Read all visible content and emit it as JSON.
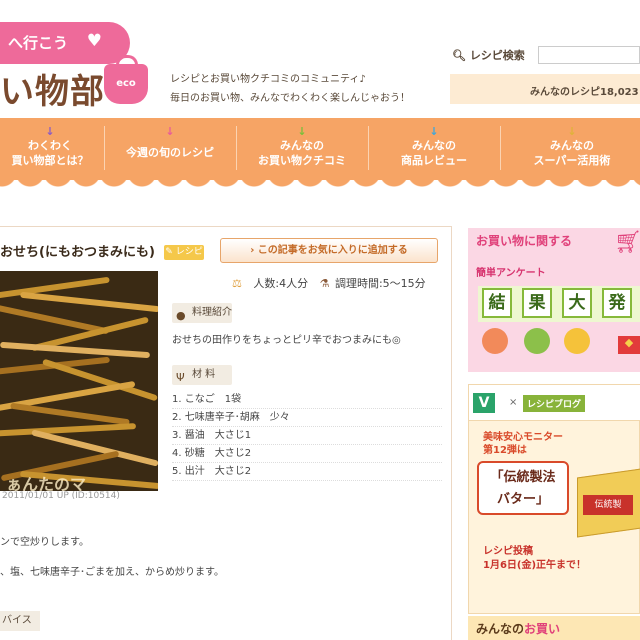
{
  "header": {
    "bubble_text": "へ行こう",
    "logo_text": "い物部",
    "eco_label": "eco",
    "tagline_1": "レシピとお買い物クチコミのコミュニティ♪",
    "tagline_2": "毎日のお買い物、みんなでわくわく楽しんじゃおう！",
    "search_label": "レシピ検索",
    "search_placeholder": "",
    "recipe_count": "みんなのレシピ18,023"
  },
  "nav": {
    "items": [
      {
        "line1": "わくわく",
        "line2": "買い物部とは？"
      },
      {
        "line1": "今週の旬のレシピ",
        "line2": ""
      },
      {
        "line1": "みんなの",
        "line2": "お買い物クチコミ"
      },
      {
        "line1": "みんなの",
        "line2": "商品レビュー"
      },
      {
        "line1": "みんなの",
        "line2": "スーパー活用術"
      }
    ]
  },
  "recipe": {
    "title": "おせち(にもおつまみにも)",
    "tag": "レシピ",
    "favorite_button": "この記事をお気に入りに追加する",
    "servings": "人数:4人分",
    "cook_time": "調理時間:5〜15分",
    "intro_label": "料理紹介",
    "intro_text": "おせちの田作りをちょっとピリ辛でおつまみにも◎",
    "ingredients_label": "材 料",
    "ingredients": [
      "1. こなご　1袋",
      "2. 七味唐辛子･胡麻　少々",
      "3. 醤油　大さじ1",
      "4. 砂糖　大さじ2",
      "5. 出汁　大さじ2"
    ],
    "photo_caption": "2011/01/01 UP (ID:10514)",
    "photo_watermark": "ぁんたのマ",
    "step_1": "ンで空炒りします。",
    "step_2": "、塩、七味唐辛子･ごまを加え、からめ炒ります。",
    "advice_label": "バイス"
  },
  "sidebar": {
    "survey": {
      "line1": "お買い物に関する",
      "line2": "簡単アンケート",
      "tiles": [
        "結",
        "果",
        "大",
        "発"
      ]
    },
    "monitor": {
      "x_mark": "×",
      "blog_label": "レシピブログ",
      "line1": "美味安心モニター",
      "line2": "第12弾は",
      "product_1": "「伝統製法",
      "product_2": "バター」",
      "box_label": "伝統製",
      "deadline_1": "レシピ投稿",
      "deadline_2": "1月6日(金)正午まで！"
    },
    "bottom_a": "みんなの",
    "bottom_b": "お買い"
  },
  "colors": {
    "nav_orange": "#f6a465",
    "brand_pink": "#ee6a9a",
    "logo_brown": "#7a4a2e",
    "button_text": "#c46b28"
  }
}
